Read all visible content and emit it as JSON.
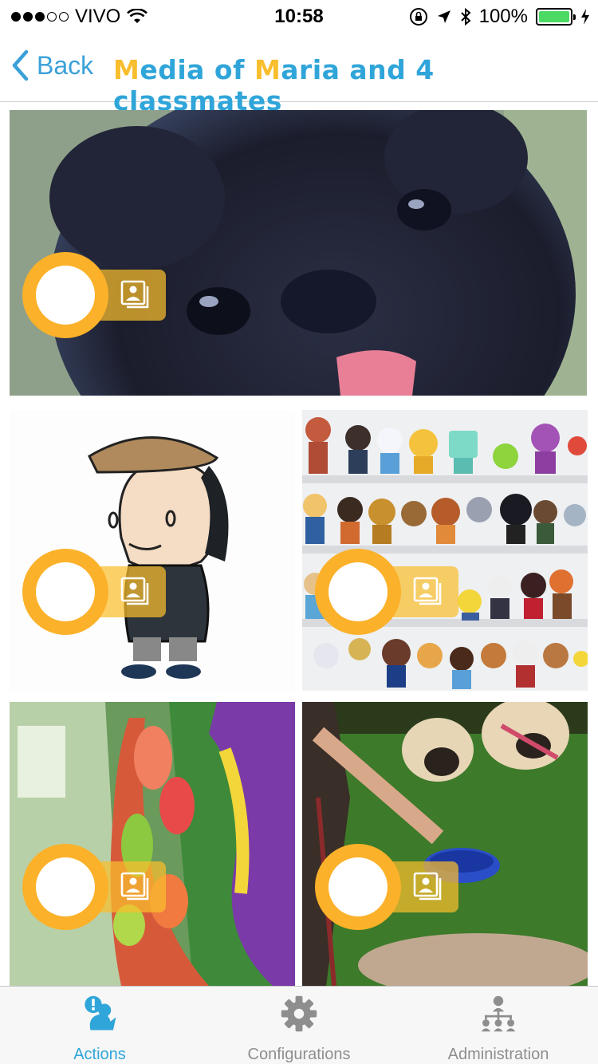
{
  "status_bar": {
    "carrier": "VIVO",
    "time": "10:58",
    "battery": "100%"
  },
  "nav": {
    "back_label": "Back",
    "title_parts": [
      {
        "text": "M",
        "accent": true
      },
      {
        "text": "edia of ",
        "accent": false
      },
      {
        "text": "M",
        "accent": true
      },
      {
        "text": "aria and 4 classmates",
        "accent": false
      }
    ]
  },
  "colors": {
    "accent_blue": "#2fa5d9",
    "accent_yellow": "#f9be2d",
    "tab_inactive": "#8e8e8e"
  },
  "media": [
    {
      "name": "media-item-pug-closeup",
      "subject": "black pug close-up photo",
      "type": "photo"
    },
    {
      "name": "media-item-cartoon-boy",
      "subject": "cartoon boy with cap",
      "type": "photo"
    },
    {
      "name": "media-item-toy-shelves",
      "subject": "shelves of toy figures",
      "type": "photo"
    },
    {
      "name": "media-item-candy-bag",
      "subject": "bag of gummy candy",
      "type": "photo"
    },
    {
      "name": "media-item-pugs-grass",
      "subject": "pugs on grass",
      "type": "photo"
    }
  ],
  "tabs": [
    {
      "label": "Actions",
      "icon": "actions-icon",
      "active": true
    },
    {
      "label": "Configurations",
      "icon": "gear-icon",
      "active": false
    },
    {
      "label": "Administration",
      "icon": "administration-icon",
      "active": false
    }
  ]
}
